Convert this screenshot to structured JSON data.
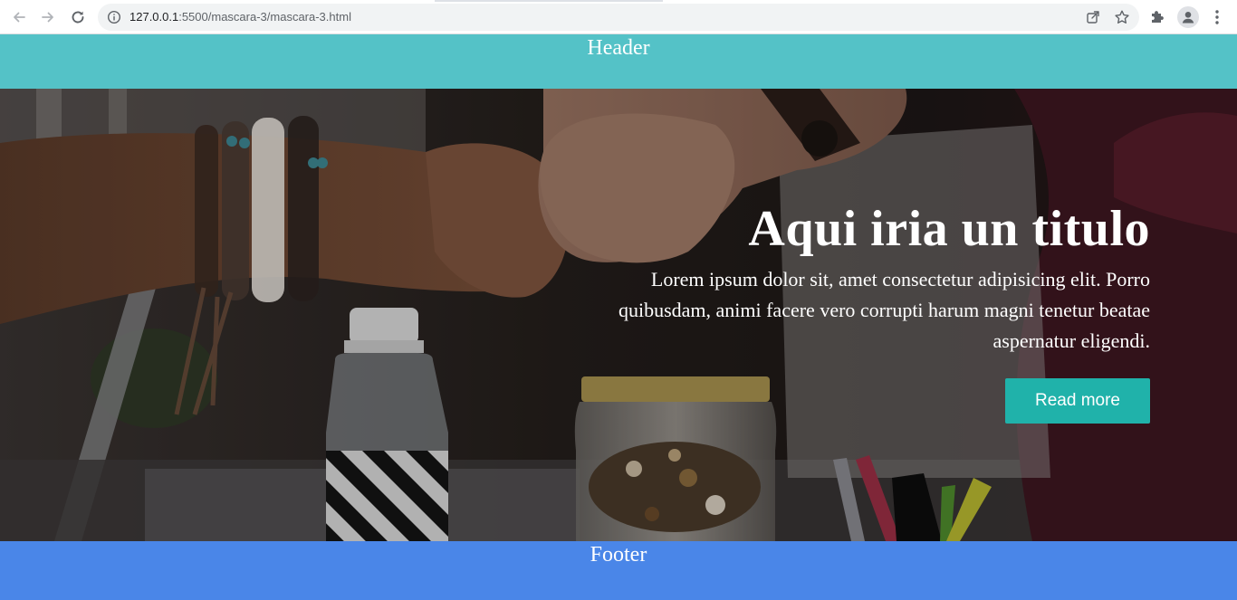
{
  "browser": {
    "url_host": "127.0.0.1",
    "url_path": ":5500/mascara-3/mascara-3.html",
    "icons": {
      "back": "arrow-left-icon",
      "forward": "arrow-right-icon",
      "reload": "reload-icon",
      "site_info": "info-icon",
      "share": "share-icon",
      "bookmark": "star-icon",
      "extensions": "puzzle-icon",
      "profile": "avatar-icon",
      "menu": "kebab-menu-icon"
    }
  },
  "header": {
    "label": "Header",
    "color": "#54c2c7"
  },
  "hero": {
    "title": "Aqui iria un titulo",
    "text": "Lorem ipsum dolor sit, amet consectetur adipisicing elit. Porro quibusdam, animi facere vero corrupti harum magni tenetur beatae aspernatur eligendi.",
    "button_label": "Read more",
    "button_color": "#20b2aa"
  },
  "footer": {
    "label": "Footer",
    "color": "#4a86e8"
  }
}
